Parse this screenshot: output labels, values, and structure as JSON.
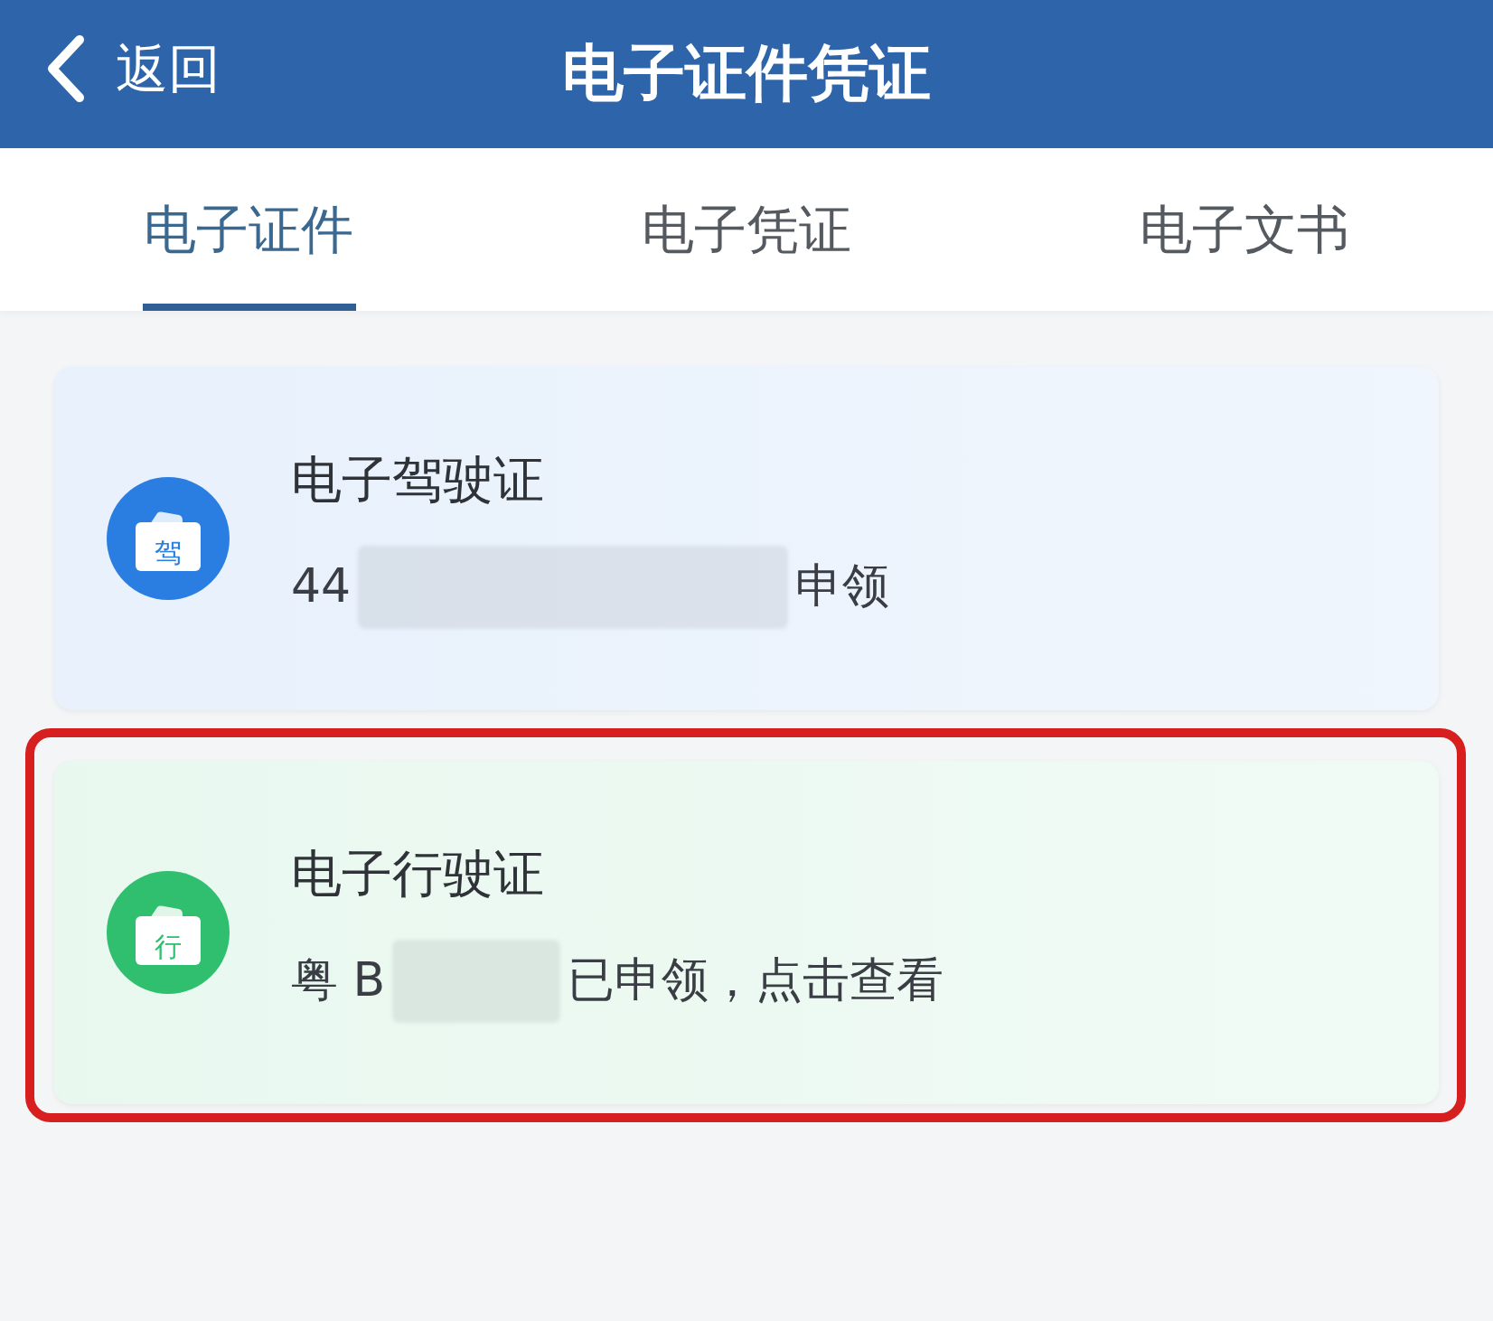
{
  "header": {
    "back_label": "返回",
    "title": "电子证件凭证"
  },
  "tabs": [
    {
      "label": "电子证件",
      "selected": true
    },
    {
      "label": "电子凭证",
      "selected": false
    },
    {
      "label": "电子文书",
      "selected": false
    }
  ],
  "cards": [
    {
      "icon_char": "驾",
      "color": "#2a7de1",
      "title": "电子驾驶证",
      "prefix": "44",
      "redacted": true,
      "status": "申领",
      "highlighted": false
    },
    {
      "icon_char": "行",
      "color": "#2fbf6f",
      "title": "电子行驶证",
      "prefix": "粤 B",
      "redacted": true,
      "status": "已申领，点击查看",
      "highlighted": true
    }
  ]
}
